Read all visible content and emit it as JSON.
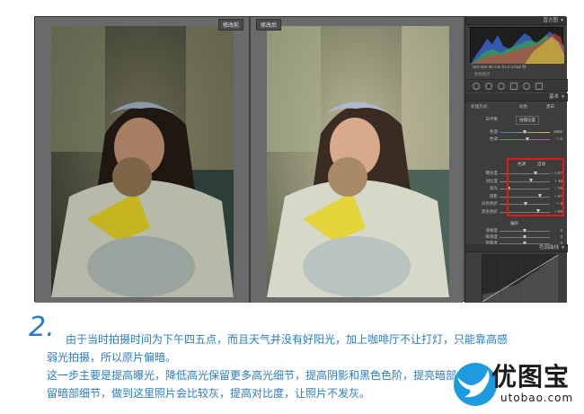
{
  "lightroom": {
    "before_label": "修改前",
    "after_label": "修改后",
    "histogram_panel": {
      "title": "直方图"
    },
    "histogram_readout": "ISO 800   85 mm   f/1.8   1/160 秒",
    "histogram_note": "原始照片",
    "basic_panel": {
      "title": "基本",
      "treatment_label": "处理方式：",
      "treatment_color": "彩色",
      "treatment_bw": "黑白",
      "wb_auto": "白平衡",
      "wb_option": "拍摄设置",
      "temp_label": "色温",
      "temp_value": "4800",
      "tint_label": "色调",
      "tint_value": "+ 6",
      "tone_label": "色调",
      "tone_auto": "自动",
      "sliders": [
        {
          "name": "exposure",
          "label": "曝光度",
          "value": "+ 1.87",
          "pos": 0.72
        },
        {
          "name": "contrast",
          "label": "对比度",
          "value": "+ 45",
          "pos": 0.64
        },
        {
          "name": "highlights",
          "label": "高光",
          "value": "- 75",
          "pos": 0.18
        },
        {
          "name": "shadows",
          "label": "阴影",
          "value": "+ 67",
          "pos": 0.82
        },
        {
          "name": "whites",
          "label": "白色色阶",
          "value": "+ 5",
          "pos": 0.52
        },
        {
          "name": "blacks",
          "label": "黑色色阶",
          "value": "+ 59",
          "pos": 0.78
        }
      ],
      "presence_label": "偏好",
      "presence_sliders": [
        {
          "name": "clarity",
          "label": "清晰度",
          "value": "0",
          "pos": 0.5
        },
        {
          "name": "vibrance",
          "label": "鲜艳度",
          "value": "0",
          "pos": 0.5
        },
        {
          "name": "saturation",
          "label": "饱和度",
          "value": "0",
          "pos": 0.5
        }
      ]
    },
    "tone_curve_panel": {
      "title": "色调曲线"
    }
  },
  "article": {
    "step_number": "2.",
    "lines": [
      "由于当时拍摄时间为下午四五点，而且天气并没有好阳光，加上咖啡厅不让打灯，只能靠高感",
      "弱光拍摄，所以原片偏暗。",
      "这一步主要是提高曝光，降低高光保留更多高光细节，提高阴影和黑色色阶，提亮暗部，保",
      "留暗部细节，做到这里照片会比较灰，提高对比度，让照片不发灰。"
    ]
  },
  "logo": {
    "name": "优图宝",
    "url": "utobao.com"
  },
  "colors": {
    "text_blue": "#2a7cc4",
    "highlight_red": "#e0191d",
    "logo_blue": "#1e9be0"
  }
}
